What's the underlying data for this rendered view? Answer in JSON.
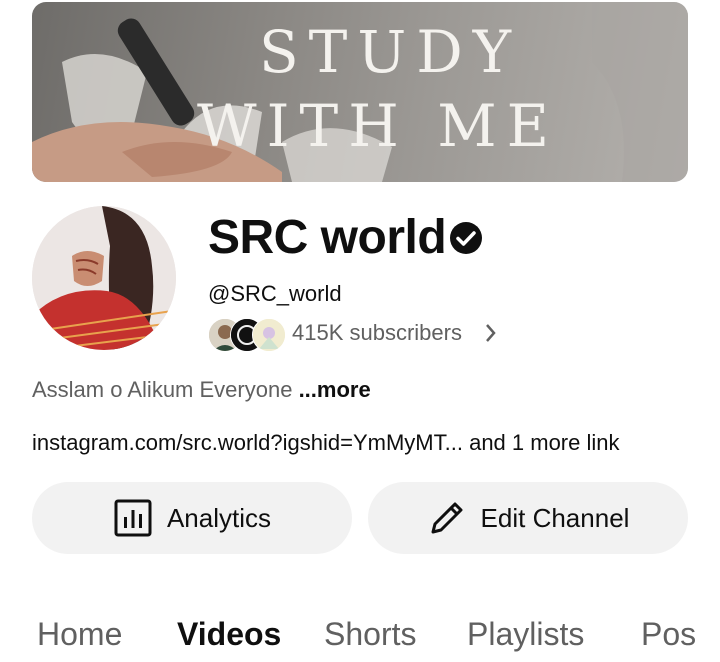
{
  "banner": {
    "line1": "STUDY",
    "line2": "WITH ME"
  },
  "channel": {
    "name": "SRC world",
    "handle": "@SRC_world",
    "subscribers": "415K subscribers",
    "description": "Asslam o Alikum Everyone",
    "description_more": "...more",
    "link": "instagram.com/src.world?igshid=YmMyMT...",
    "link_more": "and 1 more link"
  },
  "actions": {
    "analytics_label": "Analytics",
    "edit_label": "Edit Channel"
  },
  "tabs": [
    {
      "label": "Home",
      "active": false
    },
    {
      "label": "Videos",
      "active": true
    },
    {
      "label": "Shorts",
      "active": false
    },
    {
      "label": "Playlists",
      "active": false
    },
    {
      "label": "Pos",
      "active": false
    }
  ],
  "icons": {
    "verified": "verified-check-icon",
    "analytics": "bar-chart-icon",
    "edit": "pencil-icon",
    "chevron": "chevron-right-icon"
  },
  "colors": {
    "primary_text": "#0f0f0f",
    "secondary_text": "#606060",
    "button_bg": "#f2f2f2"
  }
}
